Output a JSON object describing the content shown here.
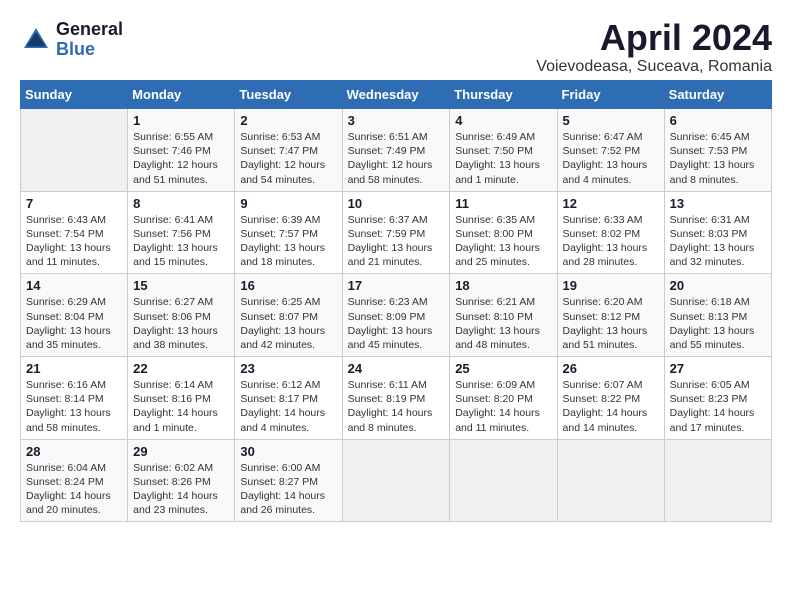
{
  "header": {
    "logo_general": "General",
    "logo_blue": "Blue",
    "month_title": "April 2024",
    "location": "Voievodeasa, Suceava, Romania"
  },
  "columns": [
    "Sunday",
    "Monday",
    "Tuesday",
    "Wednesday",
    "Thursday",
    "Friday",
    "Saturday"
  ],
  "weeks": [
    [
      {
        "day": "",
        "sunrise": "",
        "sunset": "",
        "daylight": ""
      },
      {
        "day": "1",
        "sunrise": "Sunrise: 6:55 AM",
        "sunset": "Sunset: 7:46 PM",
        "daylight": "Daylight: 12 hours and 51 minutes."
      },
      {
        "day": "2",
        "sunrise": "Sunrise: 6:53 AM",
        "sunset": "Sunset: 7:47 PM",
        "daylight": "Daylight: 12 hours and 54 minutes."
      },
      {
        "day": "3",
        "sunrise": "Sunrise: 6:51 AM",
        "sunset": "Sunset: 7:49 PM",
        "daylight": "Daylight: 12 hours and 58 minutes."
      },
      {
        "day": "4",
        "sunrise": "Sunrise: 6:49 AM",
        "sunset": "Sunset: 7:50 PM",
        "daylight": "Daylight: 13 hours and 1 minute."
      },
      {
        "day": "5",
        "sunrise": "Sunrise: 6:47 AM",
        "sunset": "Sunset: 7:52 PM",
        "daylight": "Daylight: 13 hours and 4 minutes."
      },
      {
        "day": "6",
        "sunrise": "Sunrise: 6:45 AM",
        "sunset": "Sunset: 7:53 PM",
        "daylight": "Daylight: 13 hours and 8 minutes."
      }
    ],
    [
      {
        "day": "7",
        "sunrise": "Sunrise: 6:43 AM",
        "sunset": "Sunset: 7:54 PM",
        "daylight": "Daylight: 13 hours and 11 minutes."
      },
      {
        "day": "8",
        "sunrise": "Sunrise: 6:41 AM",
        "sunset": "Sunset: 7:56 PM",
        "daylight": "Daylight: 13 hours and 15 minutes."
      },
      {
        "day": "9",
        "sunrise": "Sunrise: 6:39 AM",
        "sunset": "Sunset: 7:57 PM",
        "daylight": "Daylight: 13 hours and 18 minutes."
      },
      {
        "day": "10",
        "sunrise": "Sunrise: 6:37 AM",
        "sunset": "Sunset: 7:59 PM",
        "daylight": "Daylight: 13 hours and 21 minutes."
      },
      {
        "day": "11",
        "sunrise": "Sunrise: 6:35 AM",
        "sunset": "Sunset: 8:00 PM",
        "daylight": "Daylight: 13 hours and 25 minutes."
      },
      {
        "day": "12",
        "sunrise": "Sunrise: 6:33 AM",
        "sunset": "Sunset: 8:02 PM",
        "daylight": "Daylight: 13 hours and 28 minutes."
      },
      {
        "day": "13",
        "sunrise": "Sunrise: 6:31 AM",
        "sunset": "Sunset: 8:03 PM",
        "daylight": "Daylight: 13 hours and 32 minutes."
      }
    ],
    [
      {
        "day": "14",
        "sunrise": "Sunrise: 6:29 AM",
        "sunset": "Sunset: 8:04 PM",
        "daylight": "Daylight: 13 hours and 35 minutes."
      },
      {
        "day": "15",
        "sunrise": "Sunrise: 6:27 AM",
        "sunset": "Sunset: 8:06 PM",
        "daylight": "Daylight: 13 hours and 38 minutes."
      },
      {
        "day": "16",
        "sunrise": "Sunrise: 6:25 AM",
        "sunset": "Sunset: 8:07 PM",
        "daylight": "Daylight: 13 hours and 42 minutes."
      },
      {
        "day": "17",
        "sunrise": "Sunrise: 6:23 AM",
        "sunset": "Sunset: 8:09 PM",
        "daylight": "Daylight: 13 hours and 45 minutes."
      },
      {
        "day": "18",
        "sunrise": "Sunrise: 6:21 AM",
        "sunset": "Sunset: 8:10 PM",
        "daylight": "Daylight: 13 hours and 48 minutes."
      },
      {
        "day": "19",
        "sunrise": "Sunrise: 6:20 AM",
        "sunset": "Sunset: 8:12 PM",
        "daylight": "Daylight: 13 hours and 51 minutes."
      },
      {
        "day": "20",
        "sunrise": "Sunrise: 6:18 AM",
        "sunset": "Sunset: 8:13 PM",
        "daylight": "Daylight: 13 hours and 55 minutes."
      }
    ],
    [
      {
        "day": "21",
        "sunrise": "Sunrise: 6:16 AM",
        "sunset": "Sunset: 8:14 PM",
        "daylight": "Daylight: 13 hours and 58 minutes."
      },
      {
        "day": "22",
        "sunrise": "Sunrise: 6:14 AM",
        "sunset": "Sunset: 8:16 PM",
        "daylight": "Daylight: 14 hours and 1 minute."
      },
      {
        "day": "23",
        "sunrise": "Sunrise: 6:12 AM",
        "sunset": "Sunset: 8:17 PM",
        "daylight": "Daylight: 14 hours and 4 minutes."
      },
      {
        "day": "24",
        "sunrise": "Sunrise: 6:11 AM",
        "sunset": "Sunset: 8:19 PM",
        "daylight": "Daylight: 14 hours and 8 minutes."
      },
      {
        "day": "25",
        "sunrise": "Sunrise: 6:09 AM",
        "sunset": "Sunset: 8:20 PM",
        "daylight": "Daylight: 14 hours and 11 minutes."
      },
      {
        "day": "26",
        "sunrise": "Sunrise: 6:07 AM",
        "sunset": "Sunset: 8:22 PM",
        "daylight": "Daylight: 14 hours and 14 minutes."
      },
      {
        "day": "27",
        "sunrise": "Sunrise: 6:05 AM",
        "sunset": "Sunset: 8:23 PM",
        "daylight": "Daylight: 14 hours and 17 minutes."
      }
    ],
    [
      {
        "day": "28",
        "sunrise": "Sunrise: 6:04 AM",
        "sunset": "Sunset: 8:24 PM",
        "daylight": "Daylight: 14 hours and 20 minutes."
      },
      {
        "day": "29",
        "sunrise": "Sunrise: 6:02 AM",
        "sunset": "Sunset: 8:26 PM",
        "daylight": "Daylight: 14 hours and 23 minutes."
      },
      {
        "day": "30",
        "sunrise": "Sunrise: 6:00 AM",
        "sunset": "Sunset: 8:27 PM",
        "daylight": "Daylight: 14 hours and 26 minutes."
      },
      {
        "day": "",
        "sunrise": "",
        "sunset": "",
        "daylight": ""
      },
      {
        "day": "",
        "sunrise": "",
        "sunset": "",
        "daylight": ""
      },
      {
        "day": "",
        "sunrise": "",
        "sunset": "",
        "daylight": ""
      },
      {
        "day": "",
        "sunrise": "",
        "sunset": "",
        "daylight": ""
      }
    ]
  ]
}
